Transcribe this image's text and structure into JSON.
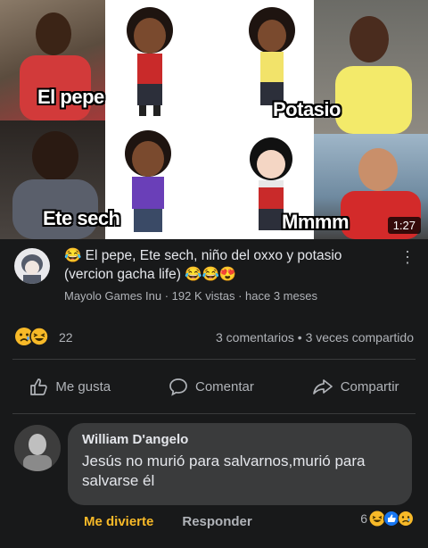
{
  "thumbnail": {
    "captions": [
      "El pepe",
      "Potasio",
      "Ete sech",
      "Mmmm"
    ],
    "duration": "1:27"
  },
  "video": {
    "title": "😂 El pepe, Ete sech, niño del oxxo y potasio (vercion gacha life) 😂😂😍",
    "meta": "Mayolo Games Inu · 192 K vistas · hace 3 meses",
    "more_icon": "⋮"
  },
  "reactions": {
    "count": "22",
    "stats": "3 comentarios • 3 veces compartido"
  },
  "actions": {
    "like": "Me gusta",
    "comment": "Comentar",
    "share": "Compartir"
  },
  "comment": {
    "author": "William D'angelo",
    "text": "Jesús no murió para salvarnos,murió para salvarse él",
    "haha_label": "Me divierte",
    "reply_label": "Responder",
    "reaction_count": "6"
  },
  "colors": {
    "background": "#18191a",
    "bubble": "#3a3b3c",
    "haha": "#f7b928",
    "secondary_text": "#b0b3b8"
  }
}
